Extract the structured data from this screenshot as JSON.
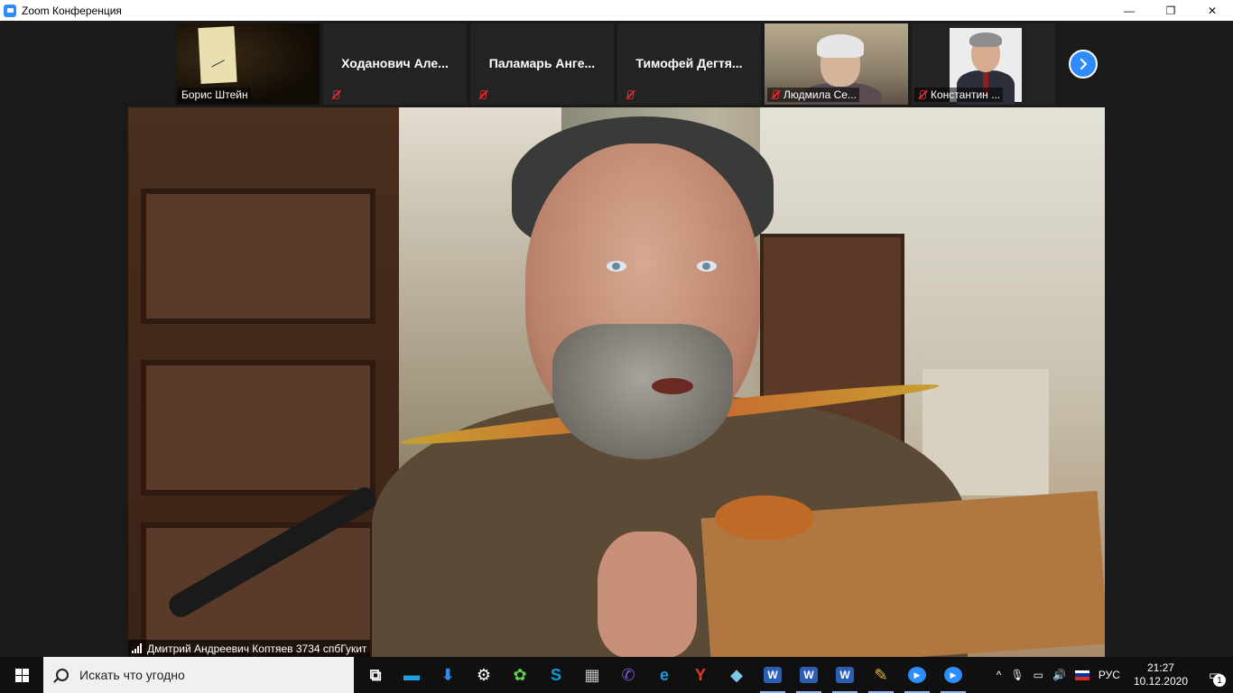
{
  "window": {
    "title": "Zoom Конференция",
    "minimize": "—",
    "maximize": "❐",
    "close": "✕"
  },
  "participants": [
    {
      "name": "Борис Штейн",
      "muted": false,
      "has_video": true
    },
    {
      "name": "Ходанович  Але...",
      "muted": true,
      "has_video": false
    },
    {
      "name": "Паламарь  Анге...",
      "muted": true,
      "has_video": false
    },
    {
      "name": "Тимофей  Дегтя...",
      "muted": true,
      "has_video": false
    },
    {
      "name": "Людмила Се...",
      "muted": true,
      "has_video": true
    },
    {
      "name": "Константин ...",
      "muted": true,
      "has_video": true
    }
  ],
  "next_button_icon": "chevron-right-icon",
  "main_speaker": {
    "label": "Дмитрий Андреевич Коптяев 3734 спбГукит"
  },
  "taskbar": {
    "search_placeholder": "Искать что угодно",
    "icons": [
      {
        "name": "task-view-icon",
        "glyph": "⧉",
        "color": "#ffffff"
      },
      {
        "name": "monitor-app-icon",
        "glyph": "▬",
        "color": "#1ea0e8"
      },
      {
        "name": "download-arrow-icon",
        "glyph": "⬇",
        "color": "#2a8de8"
      },
      {
        "name": "settings-gear-icon",
        "glyph": "⚙",
        "color": "#ffffff"
      },
      {
        "name": "icq-flower-icon",
        "glyph": "✿",
        "color": "#5fd14a"
      },
      {
        "name": "skype-icon",
        "glyph": "S",
        "color": "#0a9be0"
      },
      {
        "name": "calculator-icon",
        "glyph": "▦",
        "color": "#c0c0c0"
      },
      {
        "name": "viber-icon",
        "glyph": "✆",
        "color": "#7b58c4"
      },
      {
        "name": "edge-icon",
        "glyph": "e",
        "color": "#1f9bd6"
      },
      {
        "name": "yandex-browser-icon",
        "glyph": "Y",
        "color": "#e23a2a"
      },
      {
        "name": "sticky-notes-icon",
        "glyph": "◆",
        "color": "#7ec8e8"
      },
      {
        "name": "word-icon-1",
        "glyph": "W",
        "color": "#2b5fb3"
      },
      {
        "name": "word-icon-2",
        "glyph": "W",
        "color": "#2b5fb3"
      },
      {
        "name": "word-icon-3",
        "glyph": "W",
        "color": "#2b5fb3"
      },
      {
        "name": "paint-icon",
        "glyph": "✎",
        "color": "#e8b84a"
      },
      {
        "name": "zoom-icon-1",
        "glyph": "▶",
        "color": "#2d8cff"
      },
      {
        "name": "zoom-icon-2",
        "glyph": "▶",
        "color": "#2d8cff"
      }
    ],
    "tray": {
      "chevron": "^",
      "language": "РУС",
      "time": "21:27",
      "date": "10.12.2020",
      "notifications_count": "1"
    }
  },
  "colors": {
    "zoom_blue": "#2d8cff",
    "mute_red": "#e02828",
    "tile_bg": "#232323"
  }
}
